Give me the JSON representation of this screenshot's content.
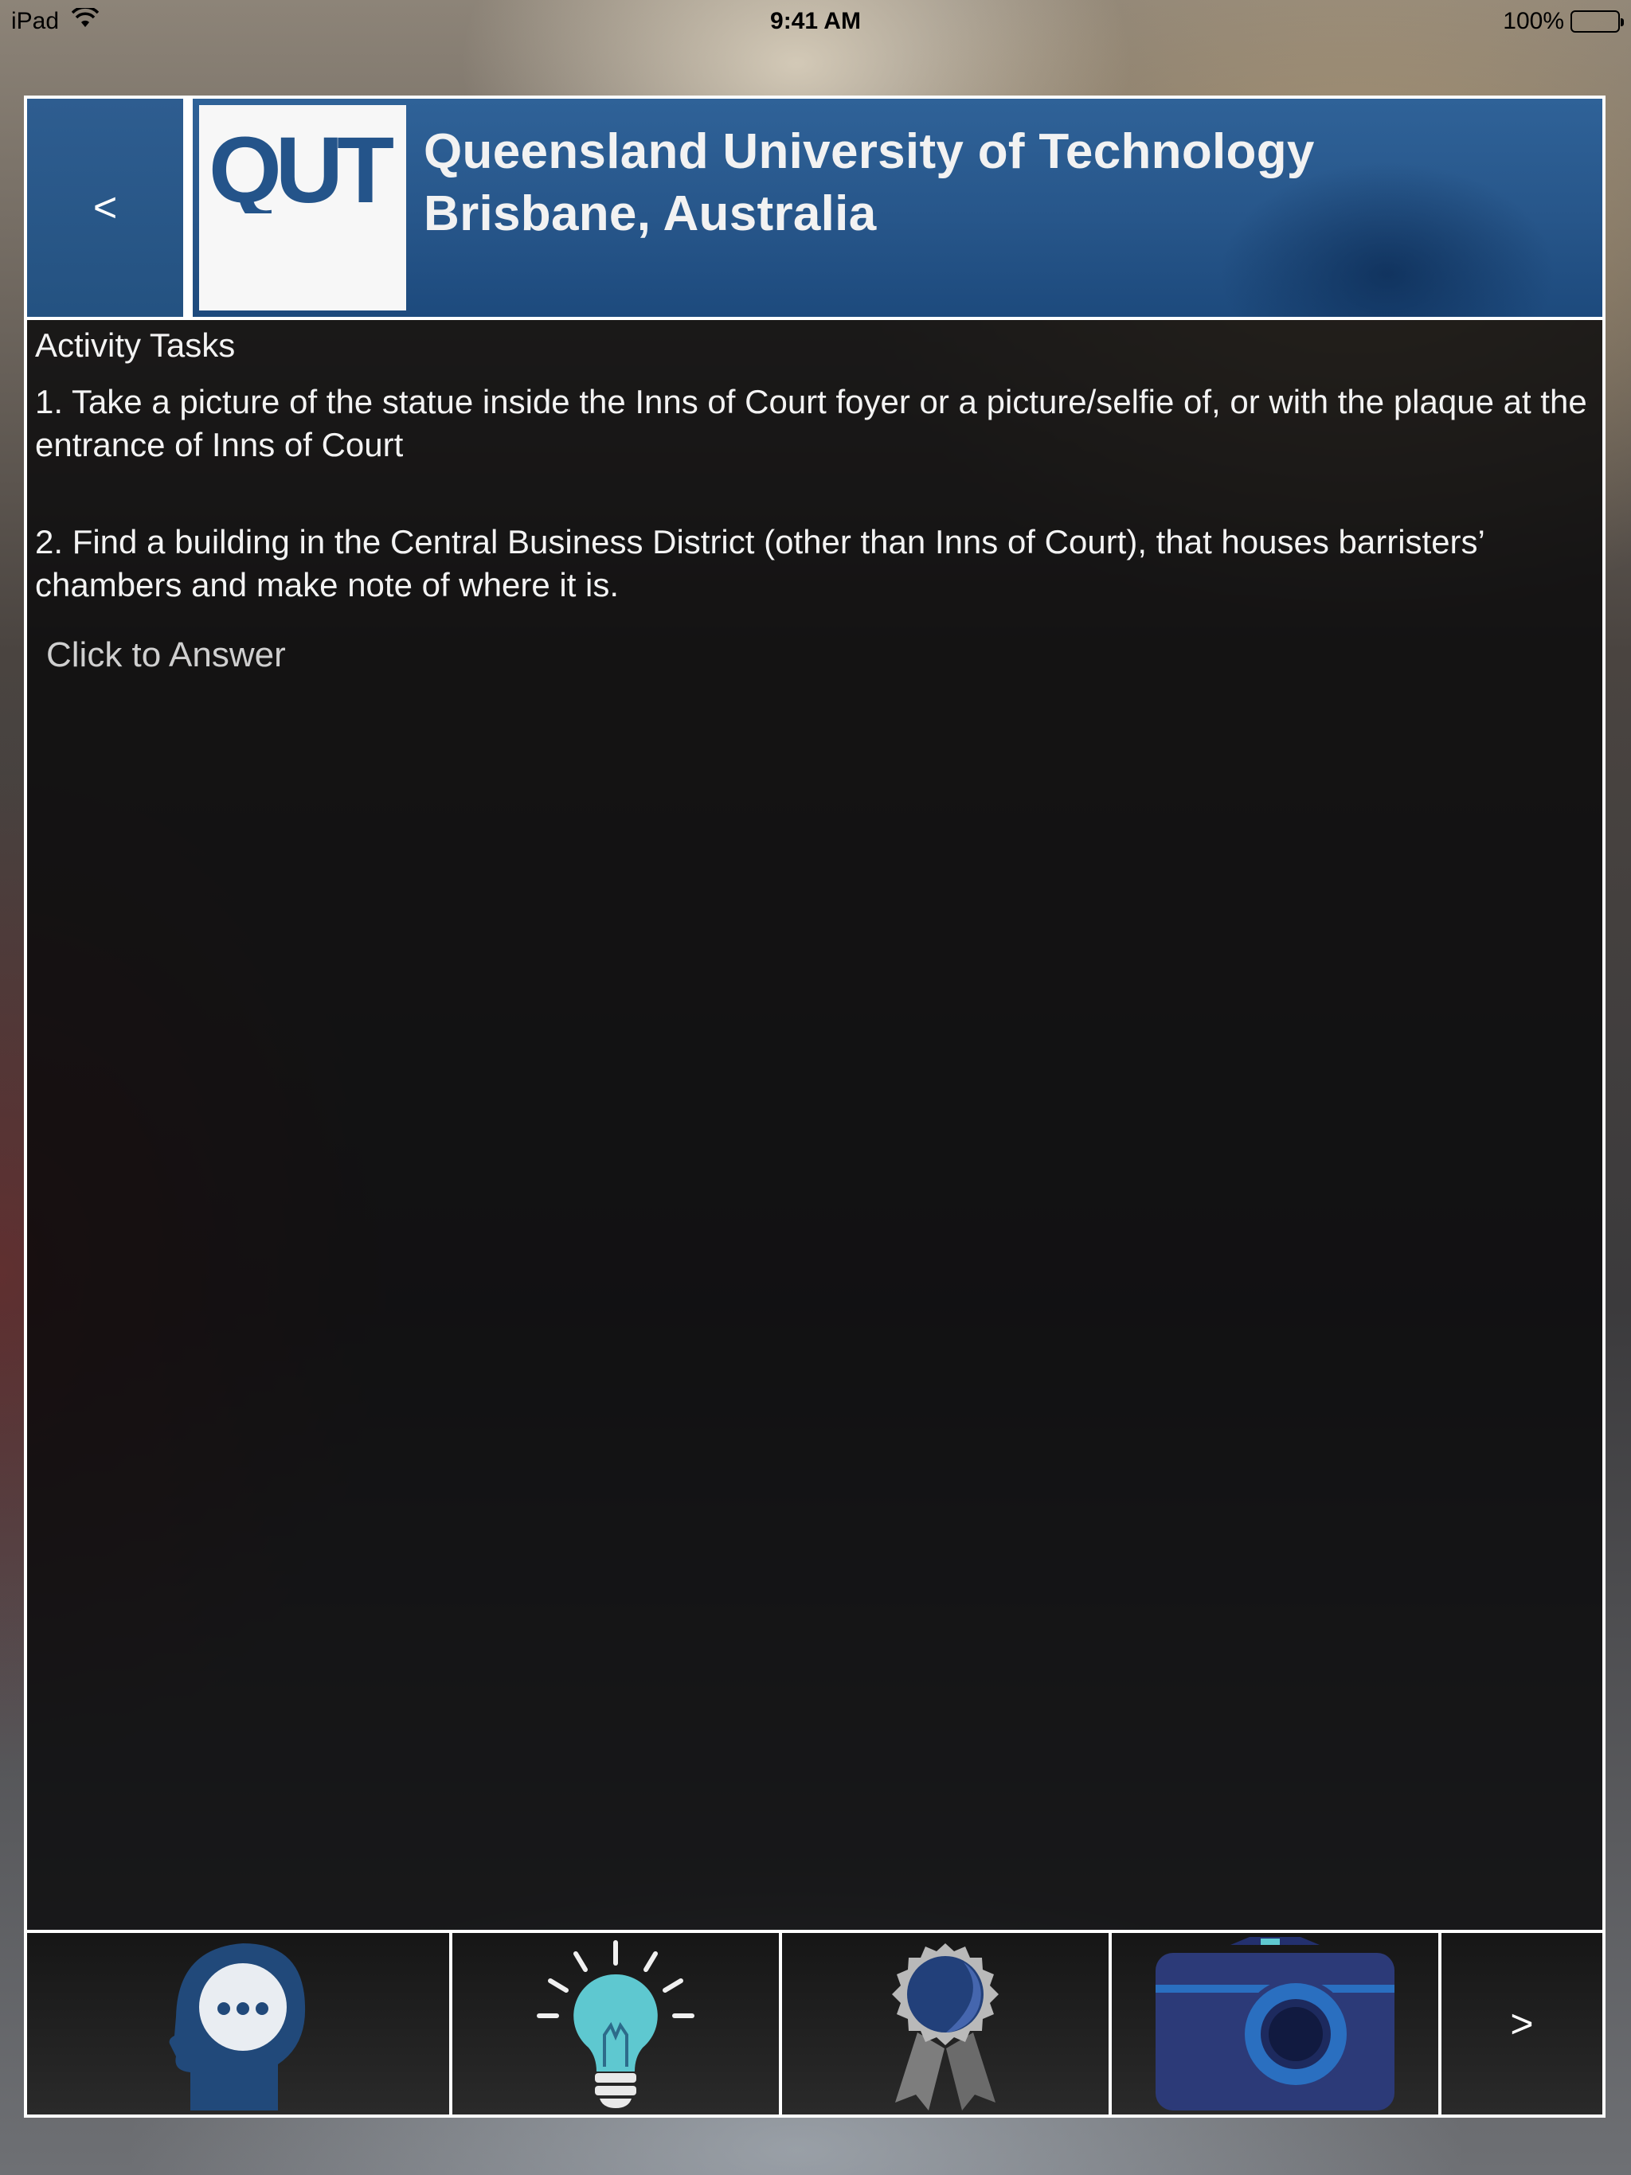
{
  "status_bar": {
    "device": "iPad",
    "time": "9:41 AM",
    "battery": "100%"
  },
  "header": {
    "back_label": "<",
    "logo_text": "QUT",
    "title_line1": "Queensland University of Technology",
    "title_line2": "Brisbane, Australia"
  },
  "content": {
    "section_title": "Activity Tasks",
    "task1": "1. Take a picture of the statue inside the Inns of Court foyer or a picture/selfie of, or with the plaque at the entrance of Inns of Court",
    "task2": "2. Find a building in the Central Business District (other than Inns of Court), that houses barristers’ chambers and make note of where it is.",
    "answer_link": "Click to Answer"
  },
  "toolbar": {
    "items": [
      {
        "icon": "thinking-head-icon"
      },
      {
        "icon": "lightbulb-icon"
      },
      {
        "icon": "award-ribbon-icon"
      },
      {
        "icon": "camera-icon"
      }
    ],
    "next_label": ">"
  },
  "colors": {
    "header_blue": "#27568a",
    "icon_dark_blue": "#21497a",
    "icon_navy": "#2c3a78",
    "icon_teal": "#5ec8d0"
  }
}
